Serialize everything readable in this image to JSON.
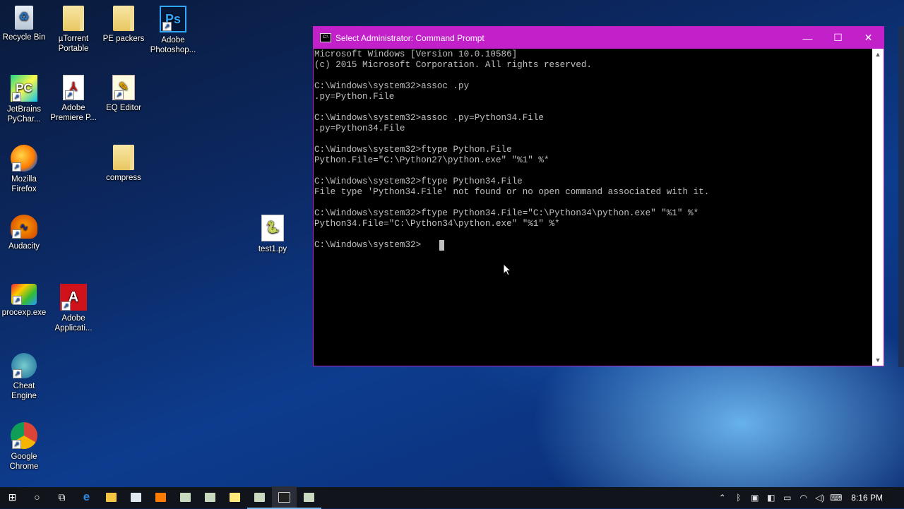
{
  "desktop": {
    "icons": [
      {
        "label": "Recycle Bin",
        "icon": "recycle-bin-icon"
      },
      {
        "label": "µTorrent Portable",
        "icon": "folder-icon"
      },
      {
        "label": "PE packers",
        "icon": "folder-icon"
      },
      {
        "label": "Adobe Photoshop...",
        "icon": "photoshop-icon",
        "glyph": "Ps"
      },
      {
        "label": "JetBrains PyChar...",
        "icon": "pycharm-icon",
        "glyph": "PC"
      },
      {
        "label": "Adobe Premiere P...",
        "icon": "pdf-file-icon"
      },
      {
        "label": "EQ Editor",
        "icon": "notepad-icon"
      },
      {
        "label": "Mozilla Firefox",
        "icon": "firefox-icon"
      },
      {
        "label": "compress",
        "icon": "folder-icon"
      },
      {
        "label": "Audacity",
        "icon": "audacity-icon"
      },
      {
        "label": "test1.py",
        "icon": "python-file-icon"
      },
      {
        "label": "procexp.exe",
        "icon": "procexp-icon"
      },
      {
        "label": "Adobe Applicati...",
        "icon": "adobe-icon"
      },
      {
        "label": "Cheat Engine",
        "icon": "cheat-engine-icon"
      },
      {
        "label": "Google Chrome",
        "icon": "chrome-icon"
      }
    ]
  },
  "cmd": {
    "title": "Select Administrator: Command Prompt",
    "lines": [
      "Microsoft Windows [Version 10.0.10586]",
      "(c) 2015 Microsoft Corporation. All rights reserved.",
      "",
      "C:\\Windows\\system32>assoc .py",
      ".py=Python.File",
      "",
      "C:\\Windows\\system32>assoc .py=Python34.File",
      ".py=Python34.File",
      "",
      "C:\\Windows\\system32>ftype Python.File",
      "Python.File=\"C:\\Python27\\python.exe\" \"%1\" %*",
      "",
      "C:\\Windows\\system32>ftype Python34.File",
      "File type 'Python34.File' not found or no open command associated with it.",
      "",
      "C:\\Windows\\system32>ftype Python34.File=\"C:\\Python34\\python.exe\" \"%1\" %*",
      "Python34.File=\"C:\\Python34\\python.exe\" \"%1\" %*",
      "",
      "C:\\Windows\\system32>"
    ],
    "controls": {
      "minimize": "—",
      "maximize": "☐",
      "close": "✕"
    },
    "title_color": "#c220c9"
  },
  "taskbar": {
    "items": [
      {
        "name": "start-button",
        "glyph": "⊞"
      },
      {
        "name": "cortana-search-button",
        "glyph": "○"
      },
      {
        "name": "task-view-button",
        "glyph": "⧉"
      },
      {
        "name": "edge-icon",
        "glyph": "e"
      },
      {
        "name": "file-explorer-icon",
        "glyph": ""
      },
      {
        "name": "store-icon",
        "glyph": ""
      },
      {
        "name": "firefox-icon",
        "glyph": ""
      },
      {
        "name": "app-icon",
        "glyph": ""
      },
      {
        "name": "app-icon",
        "glyph": ""
      },
      {
        "name": "notepad-icon",
        "glyph": ""
      },
      {
        "name": "app-icon",
        "glyph": ""
      },
      {
        "name": "cmd-icon",
        "glyph": ""
      },
      {
        "name": "app-icon",
        "glyph": ""
      }
    ],
    "clock": "8:16 PM"
  }
}
